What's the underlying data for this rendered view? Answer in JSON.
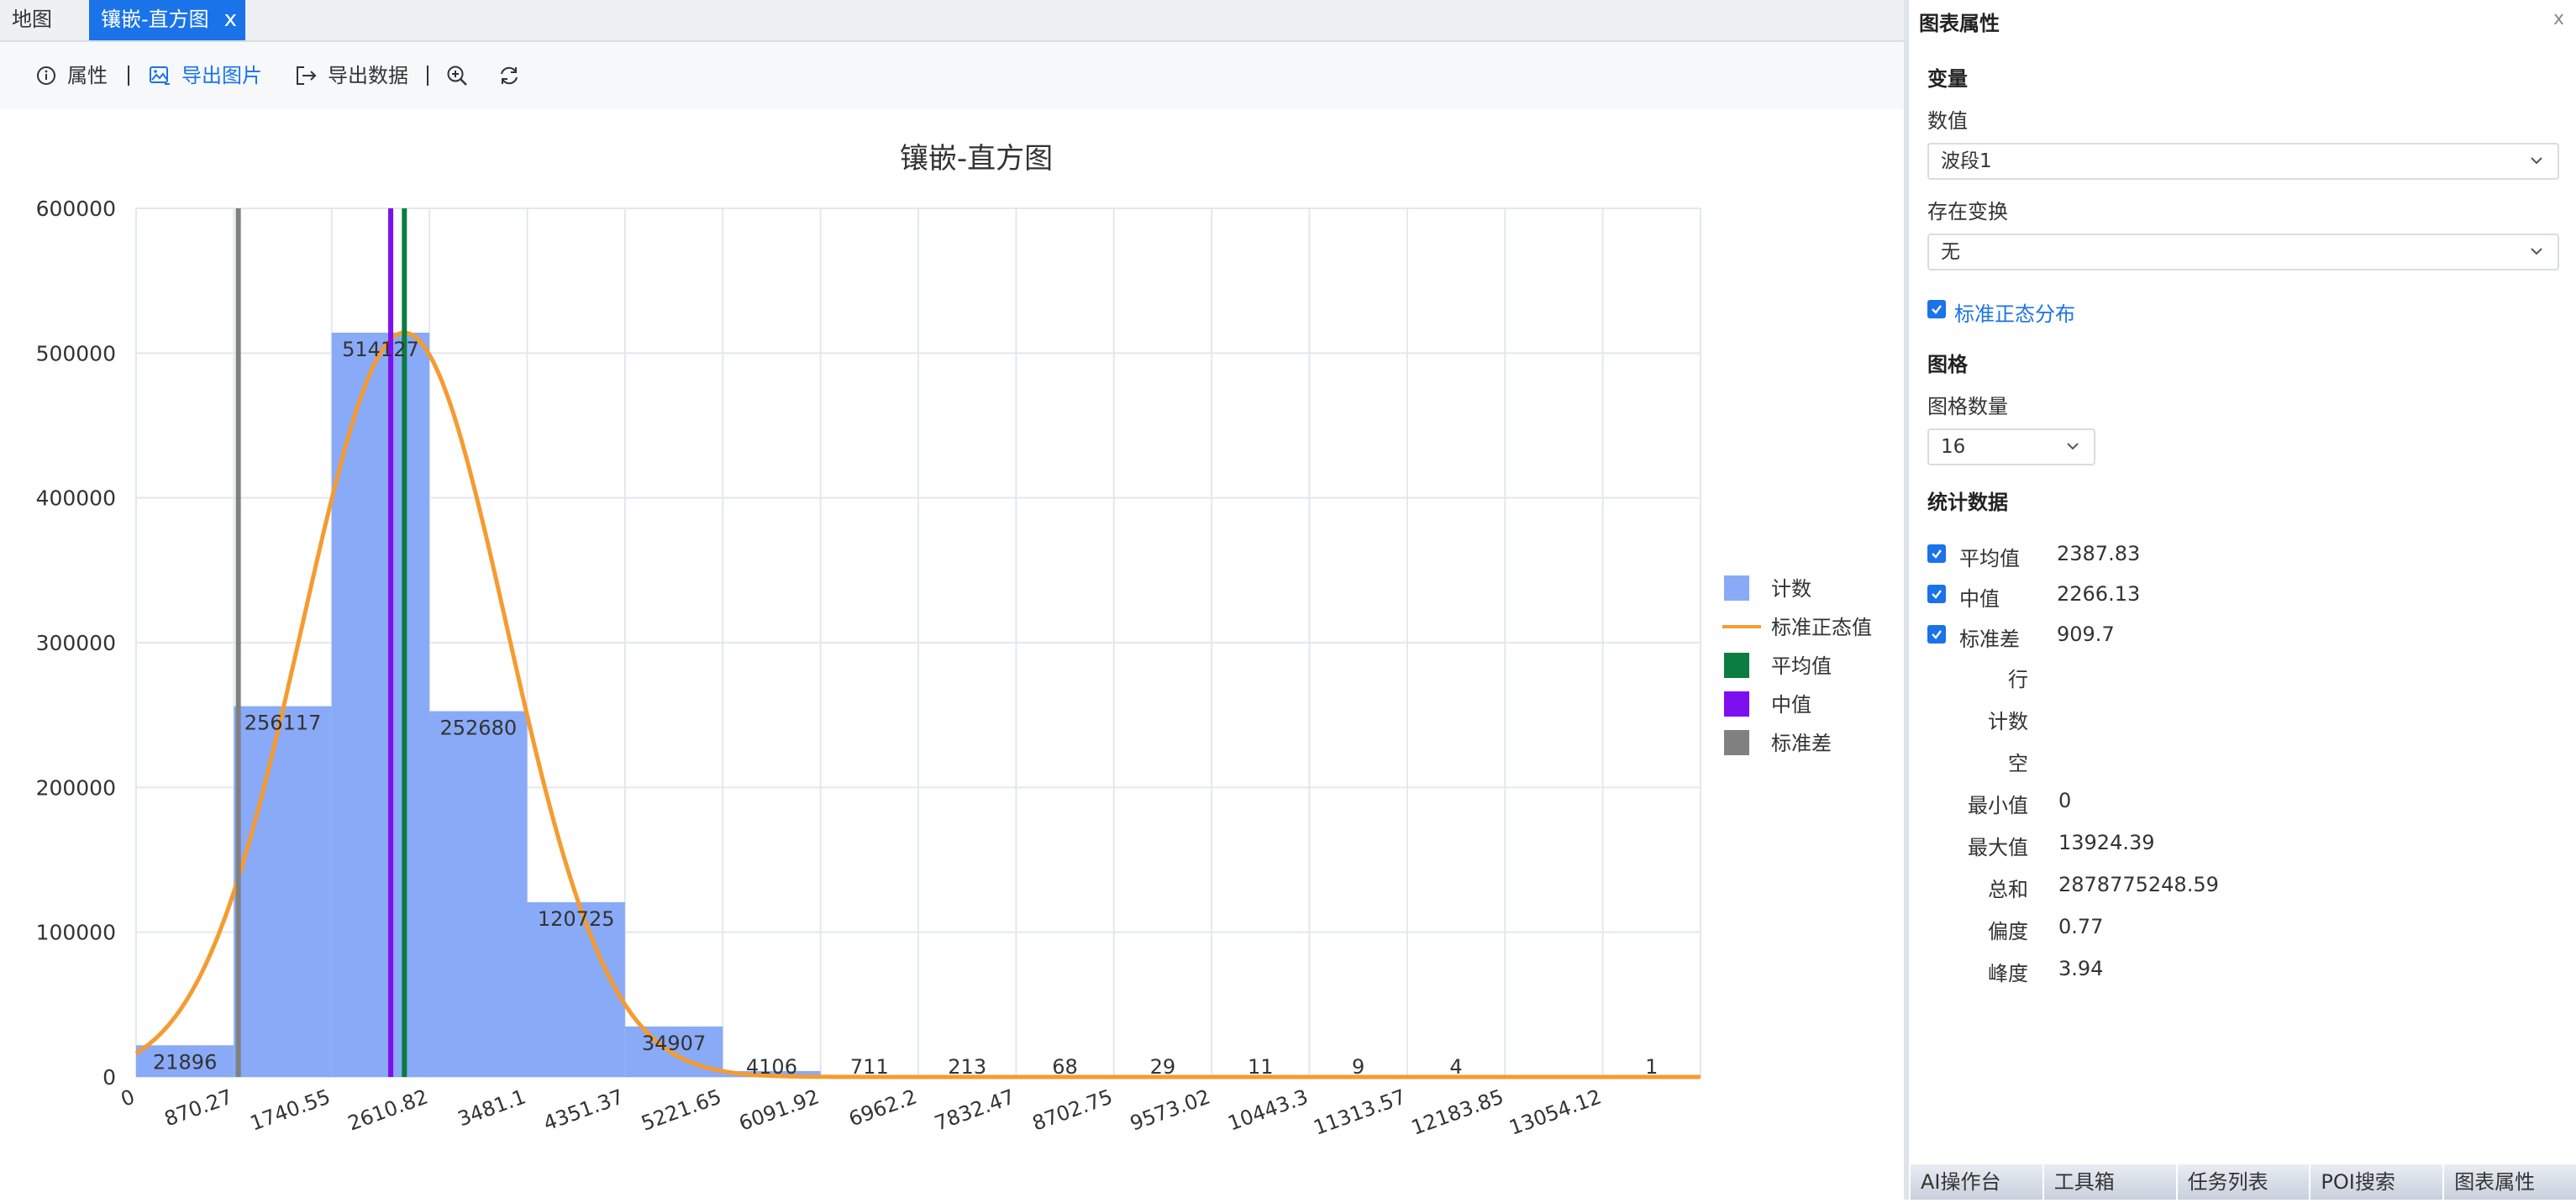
{
  "tabs": {
    "map": "地图",
    "active": "镶嵌-直方图",
    "close": "x"
  },
  "toolbar": {
    "properties": "属性",
    "export_image": "导出图片",
    "export_data": "导出数据"
  },
  "panel": {
    "title": "图表属性",
    "close": "x",
    "variable_section": "变量",
    "value_label": "数值",
    "value_selected": "波段1",
    "transform_label": "存在变换",
    "transform_selected": "无",
    "normal_checkbox": "标准正态分布",
    "grid_section": "图格",
    "grid_count_label": "图格数量",
    "grid_count_selected": "16",
    "stats_section": "统计数据",
    "stats_checked": [
      {
        "name": "平均值",
        "value": "2387.83"
      },
      {
        "name": "中值",
        "value": "2266.13"
      },
      {
        "name": "标准差",
        "value": "909.7"
      }
    ],
    "stats_plain": [
      {
        "name": "行",
        "value": ""
      },
      {
        "name": "计数",
        "value": ""
      },
      {
        "name": "空",
        "value": ""
      },
      {
        "name": "最小值",
        "value": "0"
      },
      {
        "name": "最大值",
        "value": "13924.39"
      },
      {
        "name": "总和",
        "value": "2878775248.59"
      },
      {
        "name": "偏度",
        "value": "0.77"
      },
      {
        "name": "峰度",
        "value": "3.94"
      }
    ],
    "bottom_tabs": [
      "AI操作台",
      "工具箱",
      "任务列表",
      "POI搜索",
      "图表属性"
    ]
  },
  "colors": {
    "bar": "#89aaf7",
    "curve": "#f59b30",
    "mean": "#0a7d40",
    "median": "#7e0ff0",
    "std": "#808080",
    "accent": "#1a73e8"
  },
  "chart_data": {
    "type": "bar",
    "title": "镶嵌-直方图",
    "x_tick_labels": [
      "0",
      "870.27",
      "1740.55",
      "2610.82",
      "3481.1",
      "4351.37",
      "5221.65",
      "6091.92",
      "6962.2",
      "7832.47",
      "8702.75",
      "9573.02",
      "10443.3",
      "11313.57",
      "12183.85",
      "13054.12"
    ],
    "bin_width": 870.27,
    "values": [
      21896,
      256117,
      514127,
      252680,
      120725,
      34907,
      4106,
      711,
      213,
      68,
      29,
      11,
      9,
      4,
      0,
      1
    ],
    "value_labels": [
      "21896",
      "256117",
      "514127",
      "252680",
      "120725",
      "34907",
      "4106",
      "711",
      "213",
      "68",
      "29",
      "11",
      "9",
      "4",
      "",
      "1"
    ],
    "y_tick_labels": [
      "0",
      "100000",
      "200000",
      "300000",
      "400000",
      "500000",
      "600000"
    ],
    "ylim": [
      0,
      600000
    ],
    "xlim": [
      0,
      13924.39
    ],
    "grid": true,
    "normal_curve": {
      "name": "标准正态值",
      "mean": 2387.83,
      "std": 909.7
    },
    "lines": [
      {
        "name": "平均值",
        "x": 2387.83
      },
      {
        "name": "中值",
        "x": 2266.13
      },
      {
        "name": "标准差",
        "x": 909.7
      }
    ],
    "legend": [
      "计数",
      "标准正态值",
      "平均值",
      "中值",
      "标准差"
    ],
    "legend_position": "right"
  }
}
